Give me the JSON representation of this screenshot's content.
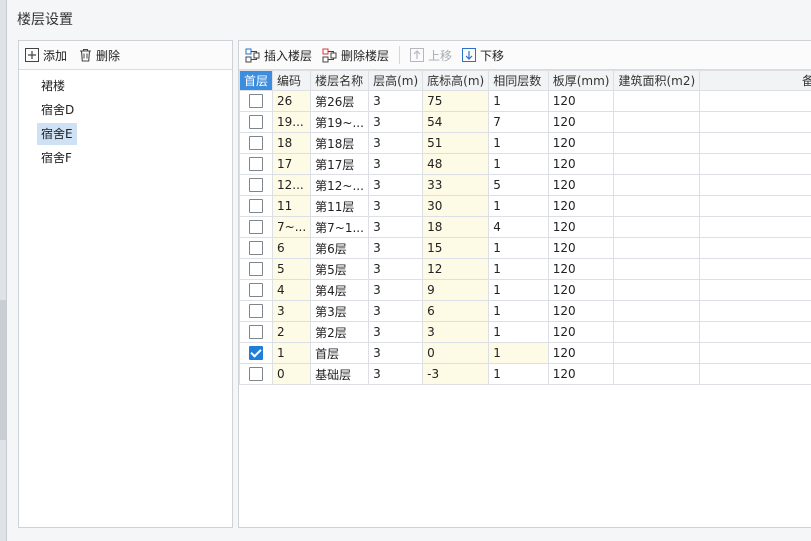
{
  "dialog": {
    "title": "楼层设置"
  },
  "left": {
    "toolbar": {
      "add_label": "添加",
      "delete_label": "删除"
    },
    "buildings": [
      {
        "label": "裙楼",
        "selected": false
      },
      {
        "label": "宿舍D",
        "selected": false
      },
      {
        "label": "宿舍E",
        "selected": true
      },
      {
        "label": "宿舍F",
        "selected": false
      }
    ]
  },
  "right": {
    "toolbar": {
      "insert_label": "插入楼层",
      "delete_label": "删除楼层",
      "up_label": "上移",
      "down_label": "下移"
    },
    "columns": [
      "首层",
      "编码",
      "楼层名称",
      "层高(m)",
      "底标高(m)",
      "相同层数",
      "板厚(mm)",
      "建筑面积(m2)",
      "备"
    ],
    "rows": [
      {
        "first": false,
        "code": "26",
        "name": "第26层",
        "height": "3",
        "elev": "75",
        "same": "1",
        "slab": "120",
        "area": "",
        "note": ""
      },
      {
        "first": false,
        "code": "19...",
        "name": "第19~...",
        "height": "3",
        "elev": "54",
        "same": "7",
        "slab": "120",
        "area": "",
        "note": ""
      },
      {
        "first": false,
        "code": "18",
        "name": "第18层",
        "height": "3",
        "elev": "51",
        "same": "1",
        "slab": "120",
        "area": "",
        "note": ""
      },
      {
        "first": false,
        "code": "17",
        "name": "第17层",
        "height": "3",
        "elev": "48",
        "same": "1",
        "slab": "120",
        "area": "",
        "note": ""
      },
      {
        "first": false,
        "code": "12...",
        "name": "第12~...",
        "height": "3",
        "elev": "33",
        "same": "5",
        "slab": "120",
        "area": "",
        "note": ""
      },
      {
        "first": false,
        "code": "11",
        "name": "第11层",
        "height": "3",
        "elev": "30",
        "same": "1",
        "slab": "120",
        "area": "",
        "note": ""
      },
      {
        "first": false,
        "code": "7~...",
        "name": "第7~1...",
        "height": "3",
        "elev": "18",
        "same": "4",
        "slab": "120",
        "area": "",
        "note": ""
      },
      {
        "first": false,
        "code": "6",
        "name": "第6层",
        "height": "3",
        "elev": "15",
        "same": "1",
        "slab": "120",
        "area": "",
        "note": ""
      },
      {
        "first": false,
        "code": "5",
        "name": "第5层",
        "height": "3",
        "elev": "12",
        "same": "1",
        "slab": "120",
        "area": "",
        "note": ""
      },
      {
        "first": false,
        "code": "4",
        "name": "第4层",
        "height": "3",
        "elev": "9",
        "same": "1",
        "slab": "120",
        "area": "",
        "note": ""
      },
      {
        "first": false,
        "code": "3",
        "name": "第3层",
        "height": "3",
        "elev": "6",
        "same": "1",
        "slab": "120",
        "area": "",
        "note": ""
      },
      {
        "first": false,
        "code": "2",
        "name": "第2层",
        "height": "3",
        "elev": "3",
        "same": "1",
        "slab": "120",
        "area": "",
        "note": ""
      },
      {
        "first": true,
        "code": "1",
        "name": "首层",
        "height": "3",
        "elev": "0",
        "same": "1",
        "slab": "120",
        "area": "",
        "note": ""
      },
      {
        "first": false,
        "code": "0",
        "name": "基础层",
        "height": "3",
        "elev": "-3",
        "same": "1",
        "slab": "120",
        "area": "",
        "note": ""
      }
    ]
  }
}
